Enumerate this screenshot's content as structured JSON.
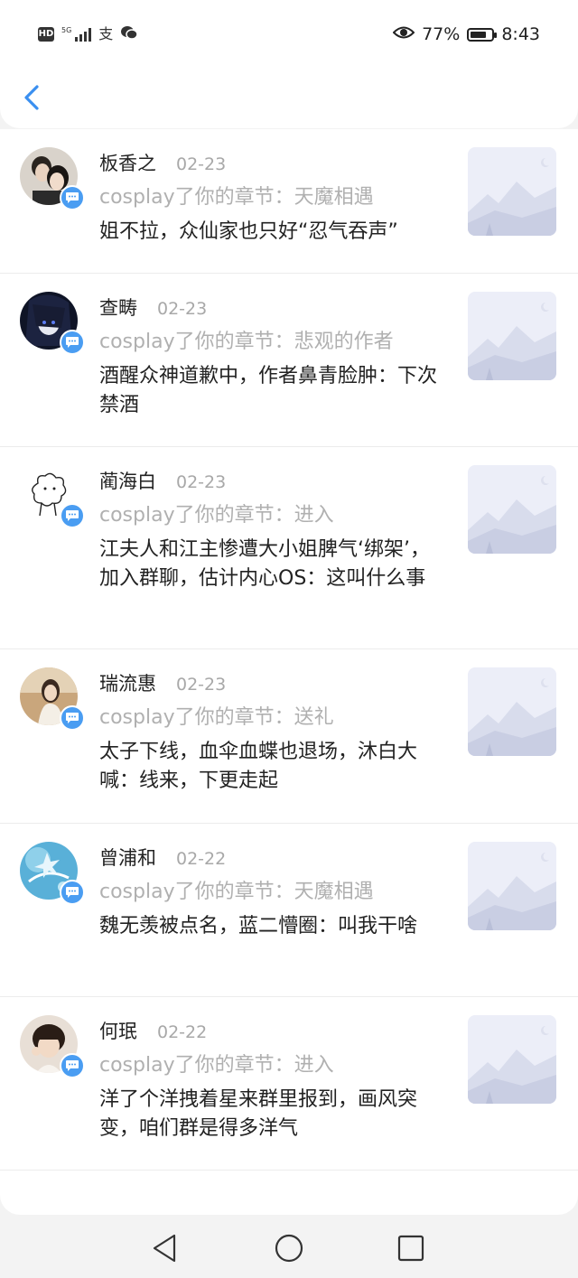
{
  "status_bar": {
    "hd": "HD",
    "network": "5G",
    "battery_percent": "77%",
    "battery_level": 0.77,
    "time": "8:43"
  },
  "header": {
    "back_icon": "chevron-left-icon"
  },
  "colors": {
    "accent": "#4a9df2",
    "secondary_text": "#b0b0b0"
  },
  "items": [
    {
      "name": "板香之",
      "date": "02-23",
      "chapter": "cosplay了你的章节：天魔相遇",
      "comment": "姐不拉，众仙家也只好“忍气吞声”",
      "avatar": "couple-photo"
    },
    {
      "name": "查畴",
      "date": "02-23",
      "chapter": "cosplay了你的章节：悲观的作者",
      "comment": "酒醒众神道歉中，作者鼻青脸肿：下次禁酒",
      "avatar": "dark-anime"
    },
    {
      "name": "蔺海白",
      "date": "02-23",
      "chapter": "cosplay了你的章节：进入",
      "comment": "江夫人和江主惨遭大小姐脾气‘绑架’，加入群聊，估计内心OS：这叫什么事",
      "avatar": "sheep-sketch"
    },
    {
      "name": "瑞流惠",
      "date": "02-23",
      "chapter": "cosplay了你的章节：送礼",
      "comment": "太子下线，血伞血蝶也退场，沐白大喊：线来，下更走起",
      "avatar": "girl-portrait"
    },
    {
      "name": "曾浦和",
      "date": "02-22",
      "chapter": "cosplay了你的章节：天魔相遇",
      "comment": "魏无羡被点名，蓝二懵圈：叫我干啥",
      "avatar": "blue-floral"
    },
    {
      "name": "何珉",
      "date": "02-22",
      "chapter": "cosplay了你的章节：进入",
      "comment": "洋了个洋拽着星来群里报到，画风突变，咱们群是得多洋气",
      "avatar": "girl-bangs"
    }
  ]
}
